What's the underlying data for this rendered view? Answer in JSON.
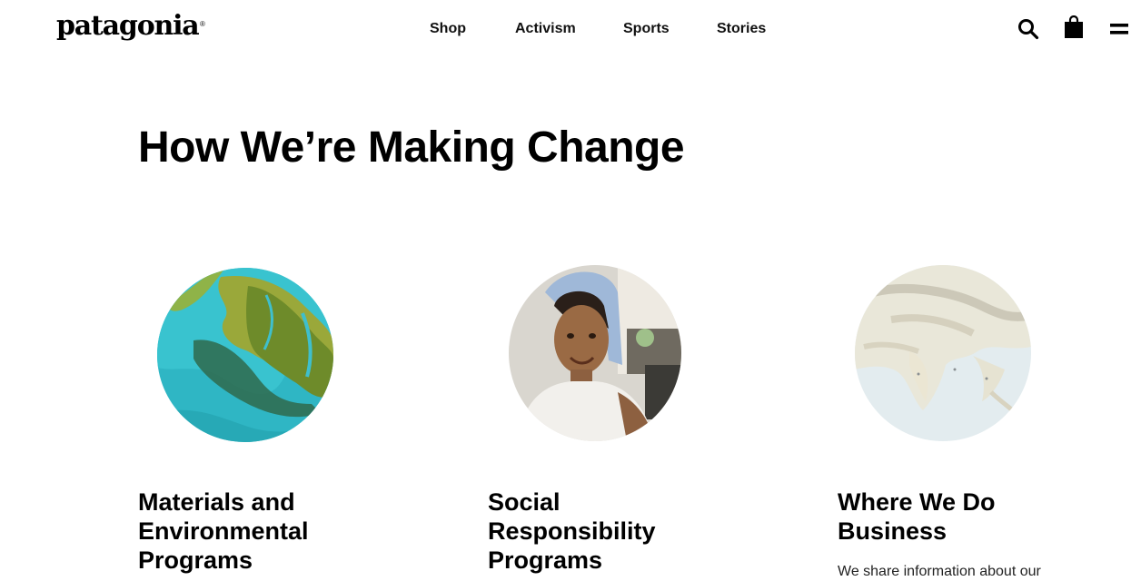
{
  "header": {
    "logo": "patagonia",
    "logo_mark": "®",
    "nav": [
      "Shop",
      "Activism",
      "Sports",
      "Stories"
    ],
    "icons": [
      "search-icon",
      "shopping-bag-icon",
      "menu-icon"
    ]
  },
  "main": {
    "title": "How We’re Making Change",
    "cards": [
      {
        "image": "aerial-delta-image",
        "title_lines": [
          "Materials and",
          "Environmental",
          "Programs"
        ]
      },
      {
        "image": "worker-portrait-image",
        "title_lines": [
          "Social",
          "Responsibility",
          "Programs"
        ]
      },
      {
        "image": "asia-map-image",
        "title_lines": [
          "Where We Do",
          "Business"
        ],
        "description": "We share information about our"
      }
    ]
  },
  "colors": {
    "text": "#000000",
    "background": "#ffffff"
  }
}
